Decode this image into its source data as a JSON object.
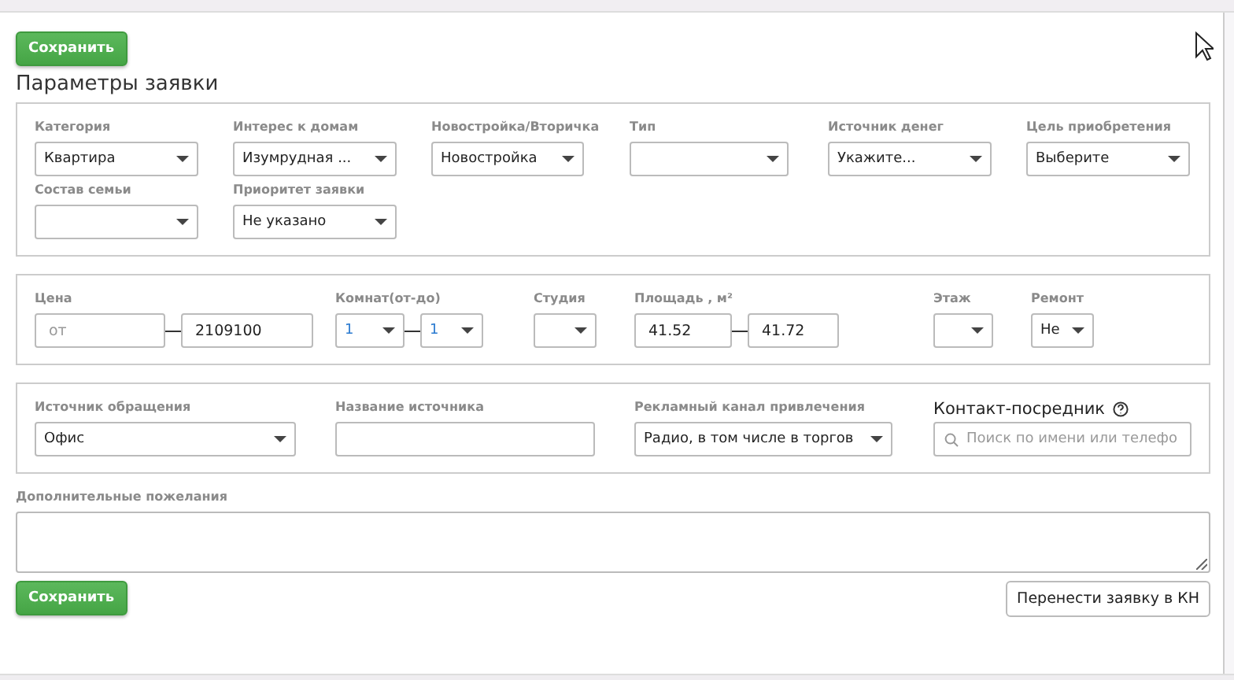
{
  "top_save_button": "Сохранить",
  "title": "Параметры заявки",
  "sections": [
    {
      "fields": [
        {
          "kind": "select",
          "label": "Категория",
          "value": "Квартира"
        },
        {
          "kind": "select",
          "label": "Интерес к домам",
          "value": "Изумрудная ..."
        },
        {
          "kind": "select",
          "label": "Новостройка/Вторичка",
          "value": "Новостройка"
        },
        {
          "kind": "select",
          "label": "Тип"
        },
        {
          "kind": "select",
          "label": "Источник денег",
          "value": "Укажите..."
        },
        {
          "kind": "select",
          "label": "Цель приобретения",
          "value": "Выберите"
        },
        {
          "kind": "select",
          "label": "Состав семьи"
        },
        {
          "kind": "select",
          "label": "Приоритет заявки",
          "value": "Не указано"
        }
      ]
    },
    {
      "fields": [
        {
          "kind": "input-range",
          "label": "Цена",
          "from": {
            "placeholder": "от"
          },
          "to": {
            "value": "2109100"
          }
        },
        {
          "kind": "select-range",
          "label": "Комнат(от-до)",
          "from": {
            "value": "1"
          },
          "to": {
            "value": "1"
          }
        },
        {
          "kind": "select",
          "label": "Студия"
        },
        {
          "kind": "input-range",
          "label": "Площадь , м²",
          "from": {
            "value": "41.52"
          },
          "to": {
            "value": "41.72"
          }
        },
        {
          "kind": "select",
          "label": "Этаж"
        },
        {
          "kind": "select",
          "label": "Ремонт",
          "value": "Не"
        }
      ]
    },
    {
      "fields": [
        {
          "kind": "select",
          "label": "Источник обращения",
          "value": "Офис"
        },
        {
          "kind": "input",
          "label": "Название источника"
        },
        {
          "kind": "select",
          "label": "Рекламный канал привлечения",
          "value": "Радио, в том числе в торгов"
        },
        {
          "kind": "search",
          "label": "Контакт-посредник",
          "placeholder": "Поиск по имени или телефо"
        }
      ]
    }
  ],
  "wishes": {
    "label": "Дополнительные пожелания"
  },
  "bottom_save_button": "Сохранить",
  "transfer_button": "Перенести заявку в КН"
}
